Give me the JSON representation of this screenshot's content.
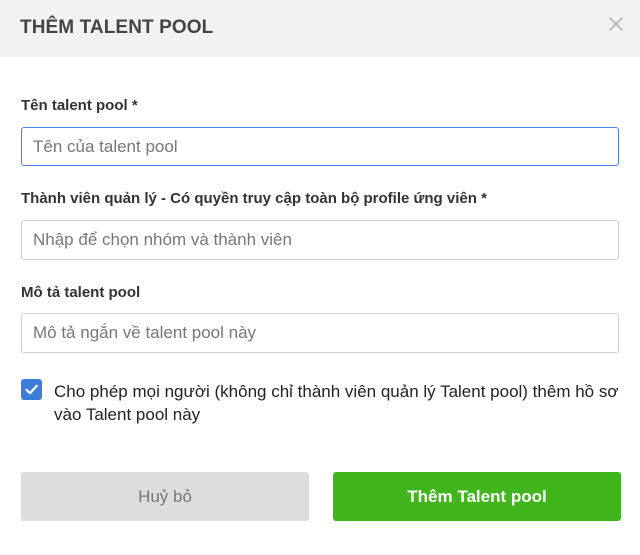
{
  "header": {
    "title": "THÊM TALENT POOL"
  },
  "form": {
    "name": {
      "label": "Tên talent pool *",
      "placeholder": "Tên của talent pool",
      "value": ""
    },
    "managers": {
      "label": "Thành viên quản lý - Có quyền truy cập toàn bộ profile ứng viên *",
      "placeholder": "Nhập để chọn nhóm và thành viên",
      "value": ""
    },
    "description": {
      "label": "Mô tả talent pool",
      "placeholder": "Mô tả ngắn về talent pool này",
      "value": ""
    },
    "allow_everyone": {
      "checked": true,
      "label": "Cho phép mọi người (không chỉ thành viên quản lý Talent pool) thêm hồ sơ vào Talent pool này"
    }
  },
  "footer": {
    "cancel_label": "Huỷ bỏ",
    "submit_label": "Thêm Talent pool"
  },
  "colors": {
    "header_bg": "#f2f2f2",
    "accent_blue": "#3b7dd8",
    "submit_green": "#40b51c",
    "cancel_gray": "#dddddd"
  },
  "icons": {
    "close": "close-icon",
    "check": "checkmark-icon"
  }
}
